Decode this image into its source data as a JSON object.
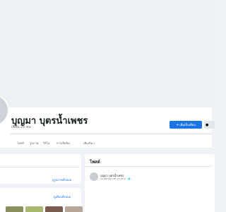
{
  "profile": {
    "name": "บุญมา บุตรน้ำเพชร",
    "friends_count": "เพื่อน 25 คน"
  },
  "actions": {
    "add_friend_icon": "+",
    "add_friend_label": "เพิ่มเป็นเพื่อน",
    "message_icon": "●"
  },
  "tabs": [
    {
      "label": "โพสต์"
    },
    {
      "label": "รูปภาพ"
    },
    {
      "label": "วิดีโอ"
    },
    {
      "label": "การเช็คอิน"
    },
    {
      "label": "เพิ่มเติม",
      "caret": "▾"
    }
  ],
  "left_cards": {
    "see_all_photos": "ดูรูปภาพทั้งหมด",
    "see_all_friends": "ดูเพื่อนทั้งหมด"
  },
  "posts_section": {
    "title": "โพสต์",
    "post": {
      "author": "บุญมา บุตรน้ำเพชร",
      "meta": "10 สิงหาคม เวลา 23:39 น. · 🌐"
    }
  },
  "colors": {
    "accent": "#1b74e4",
    "background": "#f0f2f5"
  }
}
